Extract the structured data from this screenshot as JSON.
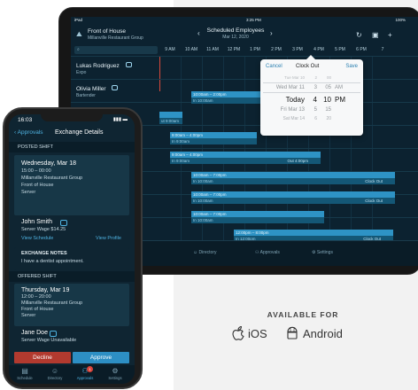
{
  "ipad": {
    "status": {
      "left": "iPad",
      "time": "3:25 PM",
      "battery": "100%"
    },
    "header": {
      "location": "Front of House",
      "org": "Millanville Restaurant Group",
      "title": "Scheduled Employees",
      "date": "Mar 12, 2020"
    },
    "hours": [
      "9 AM",
      "10 AM",
      "11 AM",
      "12 PM",
      "1 PM",
      "2 PM",
      "3 PM",
      "4 PM",
      "5 PM",
      "6 PM",
      "7"
    ],
    "employees": [
      {
        "name": "Lukas Rodriguez",
        "role": "Expo"
      },
      {
        "name": "Olivia Miller",
        "role": "Bartender"
      }
    ],
    "shifts": [
      {
        "label": "10:00am – 2:00pm",
        "sub": "In 10:00am",
        "out": ""
      },
      {
        "label": "",
        "sub": "ut 9:00am",
        "out": ""
      },
      {
        "label": "9:00am – 4:00pm",
        "sub": "In 9:00am",
        "out": ""
      },
      {
        "label": "9:00am – 4:00pm",
        "sub": "In 9:00am",
        "out": "Out 4:00pm"
      },
      {
        "label": "10:00am – 7:00pm",
        "sub": "In 10:00am",
        "out": "Clock Out"
      },
      {
        "label": "10:00am – 7:00pm",
        "sub": "In 10:00am",
        "out": "Clock Out"
      },
      {
        "label": "10:00am – 7:00pm",
        "sub": "In 10:00am",
        "out": ""
      },
      {
        "label": "12:00pm – 8:00pm",
        "sub": "In 12:00pm",
        "out": "Clock Out"
      },
      {
        "label": "12:00pm – 8:00pm",
        "sub": "In 12:00pm",
        "out": ""
      }
    ],
    "picker": {
      "cancel": "Cancel",
      "title": "Clock Out",
      "save": "Save",
      "rows": [
        {
          "d": "Tue Mar 10",
          "h": "2",
          "m": "00",
          "ap": ""
        },
        {
          "d": "Wed Mar 11",
          "h": "3",
          "m": "05",
          "ap": "AM"
        },
        {
          "d": "Today",
          "h": "4",
          "m": "10",
          "ap": "PM"
        },
        {
          "d": "Fri Mar 13",
          "h": "5",
          "m": "15",
          "ap": ""
        },
        {
          "d": "Sat Mar 14",
          "h": "6",
          "m": "20",
          "ap": ""
        }
      ]
    },
    "tabs": [
      "Directory",
      "Approvals",
      "Settings"
    ]
  },
  "phone": {
    "time": "16:03",
    "back": "Approvals",
    "title": "Exchange Details",
    "posted_section": "POSTED SHIFT",
    "posted": {
      "date": "Wednesday, Mar 18",
      "time": "15:00 – 00:00",
      "org": "Millanville Restaurant Group",
      "location": "Front of House",
      "role": "Server"
    },
    "posted_person": {
      "name": "John Smith",
      "wage": "Server Wage $14.25",
      "schedule": "View Schedule",
      "profile": "View Profile"
    },
    "notes_title": "EXCHANGE NOTES",
    "notes": "I have a dentist appointment.",
    "offered_section": "OFFERED SHIFT",
    "offered": {
      "date": "Thursday, Mar 19",
      "time": "12:00 – 20:00",
      "org": "Millanville Restaurant Group",
      "location": "Front of House",
      "role": "Server"
    },
    "offered_person": {
      "name": "Jane Doe",
      "wage": "Server Wage Unavailable"
    },
    "decline": "Decline",
    "approve": "Approve",
    "tabs": [
      "Schedule",
      "Directory",
      "Approvals",
      "Settings"
    ],
    "badge": "1"
  },
  "availability": {
    "title": "AVAILABLE FOR",
    "ios": "iOS",
    "android": "Android"
  }
}
